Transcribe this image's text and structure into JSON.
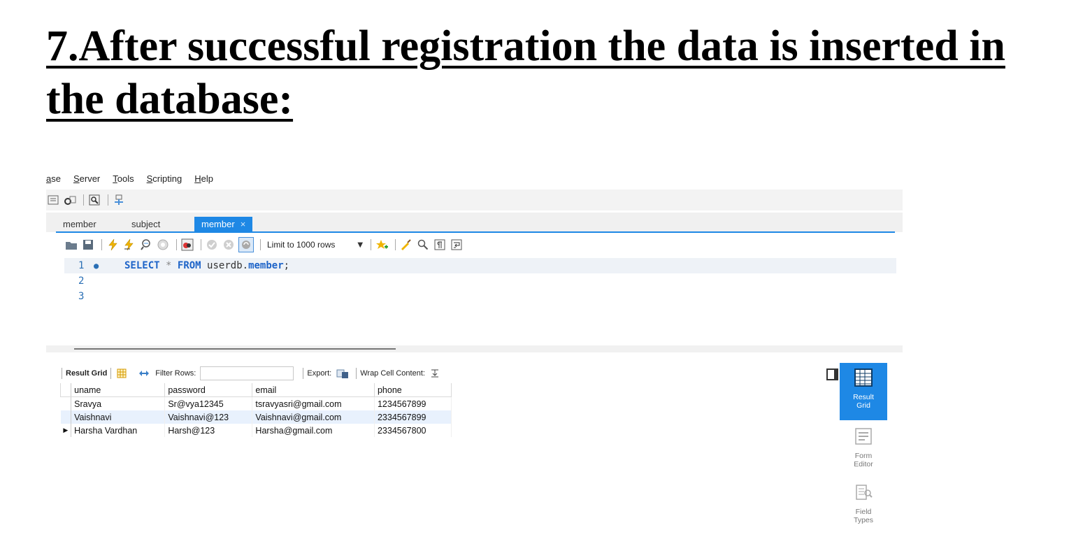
{
  "heading": "7.After successful registration the data is inserted in the database:",
  "menu": [
    "ase",
    "Server",
    "Tools",
    "Scripting",
    "Help"
  ],
  "tabs": [
    {
      "label": "member"
    },
    {
      "label": "subject"
    },
    {
      "label": "member",
      "close": "×"
    }
  ],
  "query_toolbar": {
    "limit_label": "Limit to 1000 rows"
  },
  "editor": {
    "line_numbers": [
      "1",
      "2",
      "3"
    ],
    "kw_select": "SELECT",
    "star": "*",
    "kw_from": "FROM",
    "schema": "userdb.",
    "table": "member",
    "semicolon": ";"
  },
  "result_toolbar": {
    "result_grid": "Result Grid",
    "filter_rows": "Filter Rows:",
    "export": "Export:",
    "wrap": "Wrap Cell Content:"
  },
  "grid": {
    "columns": [
      "uname",
      "password",
      "email",
      "phone"
    ],
    "rows": [
      [
        "Sravya",
        "Sr@vya12345",
        "tsravyasri@gmail.com",
        "1234567899"
      ],
      [
        "Vaishnavi",
        "Vaishnavi@123",
        "Vaishnavi@gmail.com",
        "2334567899"
      ],
      [
        "Harsha Vardhan",
        "Harsh@123",
        "Harsha@gmail.com",
        "2334567800"
      ]
    ]
  },
  "side_panel": {
    "result_grid": "Result Grid",
    "form_editor": "Form Editor",
    "field_types": "Field Types"
  },
  "colors": {
    "accent": "#1e88e5",
    "selected_row": "#e8f1fd"
  }
}
